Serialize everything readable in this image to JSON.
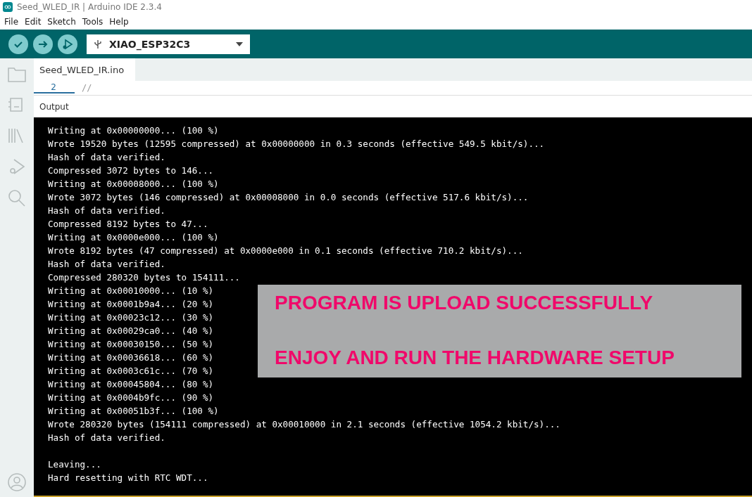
{
  "window": {
    "title": "Seed_WLED_IR | Arduino IDE 2.3.4"
  },
  "menu": [
    "File",
    "Edit",
    "Sketch",
    "Tools",
    "Help"
  ],
  "board": {
    "name": "XIAO_ESP32C3"
  },
  "editor": {
    "tab": "Seed_WLED_IR.ino",
    "line_number": "2",
    "code": "//"
  },
  "output": {
    "title": "Output",
    "blocks": [
      [
        "Writing at 0x00000000... (100 %)",
        "Wrote 19520 bytes (12595 compressed) at 0x00000000 in 0.3 seconds (effective 549.5 kbit/s)...",
        "Hash of data verified.",
        "Compressed 3072 bytes to 146...",
        "Writing at 0x00008000... (100 %)",
        "Wrote 3072 bytes (146 compressed) at 0x00008000 in 0.0 seconds (effective 517.6 kbit/s)...",
        "Hash of data verified.",
        "Compressed 8192 bytes to 47...",
        "Writing at 0x0000e000... (100 %)",
        "Wrote 8192 bytes (47 compressed) at 0x0000e000 in 0.1 seconds (effective 710.2 kbit/s)...",
        "Hash of data verified.",
        "Compressed 280320 bytes to 154111...",
        "Writing at 0x00010000... (10 %)",
        "Writing at 0x0001b9a4... (20 %)",
        "Writing at 0x00023c12... (30 %)",
        "Writing at 0x00029ca0... (40 %)",
        "Writing at 0x00030150... (50 %)",
        "Writing at 0x00036618... (60 %)",
        "Writing at 0x0003c61c... (70 %)",
        "Writing at 0x00045804... (80 %)",
        "Writing at 0x0004b9fc... (90 %)",
        "Writing at 0x00051b3f... (100 %)",
        "Wrote 280320 bytes (154111 compressed) at 0x00010000 in 2.1 seconds (effective 1054.2 kbit/s)...",
        "Hash of data verified."
      ],
      [
        "Leaving...",
        "Hard resetting with RTC WDT..."
      ]
    ]
  },
  "banner": {
    "lines": [
      "PROGRAM IS UPLOAD SUCCESSFULLY",
      "ENJOY AND RUN THE HARDWARE SETUP"
    ]
  }
}
